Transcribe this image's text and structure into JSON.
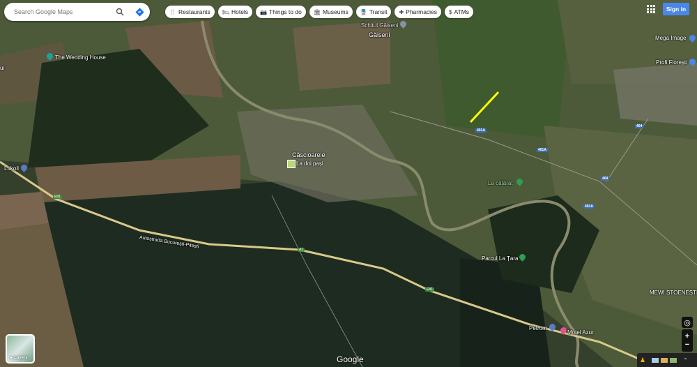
{
  "search": {
    "placeholder": "Search Google Maps",
    "search_icon": "search-icon",
    "directions_icon": "directions-icon"
  },
  "chips": [
    {
      "label": "Restaurants",
      "icon": "fork-knife-icon",
      "glyph": "🍴"
    },
    {
      "label": "Hotels",
      "icon": "bed-icon",
      "glyph": "🛏"
    },
    {
      "label": "Things to do",
      "icon": "camera-icon",
      "glyph": "📷"
    },
    {
      "label": "Museums",
      "icon": "museum-icon",
      "glyph": "🏛"
    },
    {
      "label": "Transit",
      "icon": "train-icon",
      "glyph": "🚆"
    },
    {
      "label": "Pharmacies",
      "icon": "pharmacy-icon",
      "glyph": "✚"
    },
    {
      "label": "ATMs",
      "icon": "atm-icon",
      "glyph": "$"
    }
  ],
  "header": {
    "sign_in": "Sign in"
  },
  "places": {
    "wedding": "The Wedding House",
    "schitul": "Schitul Găiseni",
    "gaiseni": "Găiseni",
    "mega": "Mega Image",
    "profi": "Profi Florești",
    "lukoil": "Lukoil",
    "cascioarele": "Căscioarele",
    "ladoipasi": "La doi pași",
    "lacatarat": "La cățărat",
    "parcul": "Parcul La Țara",
    "mewi": "MEWI STOENEȘTI",
    "petrom": "Petrom",
    "motel": "Motel Azur",
    "ui": "ui",
    "autostrada": "Autostrada București-Pitești"
  },
  "roads": {
    "e81a": "E81",
    "a1": "A1",
    "e81b": "E81",
    "r401a1": "401A",
    "r401a2": "401A",
    "r401a3": "401A",
    "r404a": "404",
    "r404b": "404"
  },
  "controls": {
    "layers": "Layers",
    "zoom_in": "+",
    "zoom_out": "−",
    "expand": "⌃"
  },
  "branding": {
    "google": "Google"
  },
  "colors": {
    "signin": "#4a87e8",
    "highlight": "#ffff00"
  }
}
